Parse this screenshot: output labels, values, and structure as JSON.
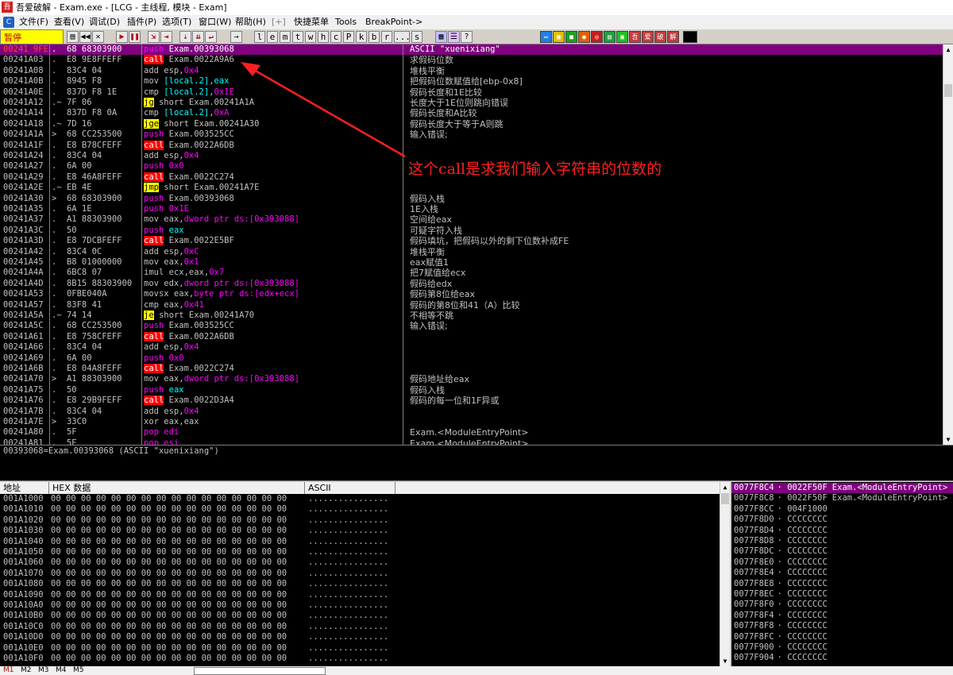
{
  "window": {
    "title": "吾爱破解 - Exam.exe - [LCG - 主线程, 模块 - Exam]",
    "icon": "52pojie-icon"
  },
  "menu": [
    "文件(F)",
    "查看(V)",
    "调试(D)",
    "插件(P)",
    "选项(T)",
    "窗口(W)",
    "帮助(H)",
    "[+]",
    "快捷菜单",
    "Tools",
    "BreakPoint->"
  ],
  "toolbar": {
    "status": "暂停",
    "letters": [
      "l",
      "e",
      "m",
      "t",
      "w",
      "h",
      "c",
      "P",
      "k",
      "b",
      "r",
      "...",
      "s"
    ],
    "tail_icons": [
      "吾",
      "爱",
      "破",
      "解"
    ]
  },
  "cpu_rows": [
    {
      "addr": "00241 9FE",
      "hex": ".  68 68303900",
      "dis": [
        [
          "push",
          "pushc"
        ],
        [
          " Exam.00393068",
          ""
        ]
      ],
      "sel": true
    },
    {
      "addr": "00241A03",
      "hex": ".  E8 9E8FFEFF",
      "dis": [
        [
          "call",
          "callbg"
        ],
        [
          " Exam.0022A9A6",
          ""
        ]
      ],
      "selcall": true
    },
    {
      "addr": "00241A08",
      "hex": ".  83C4 04",
      "dis": [
        [
          "add esp,",
          ""
        ],
        [
          "0x4",
          "imm"
        ]
      ]
    },
    {
      "addr": "00241A0B",
      "hex": ".  8945 F8",
      "dis": [
        [
          "mov ",
          ""
        ],
        [
          "[local.2]",
          "regc"
        ],
        [
          ",",
          ""
        ],
        [
          "eax",
          "regc"
        ]
      ]
    },
    {
      "addr": "00241A0E",
      "hex": ".  837D F8 1E",
      "dis": [
        [
          "cmp ",
          ""
        ],
        [
          "[local.2]",
          "regc"
        ],
        [
          ",",
          ""
        ],
        [
          "0x1E",
          "imm"
        ]
      ]
    },
    {
      "addr": "00241A12",
      "hex": ".~ 7F 06",
      "dis": [
        [
          "jg",
          "jmpbg"
        ],
        [
          " short Exam.00241A1A",
          ""
        ]
      ]
    },
    {
      "addr": "00241A14",
      "hex": ".  837D F8 0A",
      "dis": [
        [
          "cmp ",
          ""
        ],
        [
          "[local.2]",
          "regc"
        ],
        [
          ",",
          ""
        ],
        [
          "0xA",
          "imm"
        ]
      ]
    },
    {
      "addr": "00241A18",
      "hex": ".~ 7D 16",
      "dis": [
        [
          "jge",
          "jmpbg"
        ],
        [
          " short Exam.00241A30",
          ""
        ]
      ]
    },
    {
      "addr": "00241A1A",
      "hex": ">  68 CC253500",
      "dis": [
        [
          "push",
          "pushc"
        ],
        [
          " Exam.003525CC",
          ""
        ]
      ]
    },
    {
      "addr": "00241A1F",
      "hex": ".  E8 B78CFEFF",
      "dis": [
        [
          "call",
          "callbg"
        ],
        [
          " Exam.0022A6DB",
          ""
        ]
      ]
    },
    {
      "addr": "00241A24",
      "hex": ".  83C4 04",
      "dis": [
        [
          "add esp,",
          ""
        ],
        [
          "0x4",
          "imm"
        ]
      ]
    },
    {
      "addr": "00241A27",
      "hex": ".  6A 00",
      "dis": [
        [
          "push",
          "pushc"
        ],
        [
          " ",
          ""
        ],
        [
          "0x0",
          "imm"
        ]
      ]
    },
    {
      "addr": "00241A29",
      "hex": ".  E8 46A8FEFF",
      "dis": [
        [
          "call",
          "callbg"
        ],
        [
          " Exam.0022C274",
          ""
        ]
      ]
    },
    {
      "addr": "00241A2E",
      "hex": ".~ EB 4E",
      "dis": [
        [
          "jmp",
          "jmpbg"
        ],
        [
          " short Exam.00241A7E",
          ""
        ]
      ]
    },
    {
      "addr": "00241A30",
      "hex": ">  68 68303900",
      "dis": [
        [
          "push",
          "pushc"
        ],
        [
          " Exam.00393068",
          ""
        ]
      ]
    },
    {
      "addr": "00241A35",
      "hex": ".  6A 1E",
      "dis": [
        [
          "push",
          "pushc"
        ],
        [
          " ",
          ""
        ],
        [
          "0x1E",
          "imm"
        ]
      ]
    },
    {
      "addr": "00241A37",
      "hex": ".  A1 88303900",
      "dis": [
        [
          "mov eax,",
          ""
        ],
        [
          "dword ptr ds:[0x393088]",
          "memc"
        ]
      ]
    },
    {
      "addr": "00241A3C",
      "hex": ".  50",
      "dis": [
        [
          "push",
          "pushc"
        ],
        [
          " ",
          ""
        ],
        [
          "eax",
          "regc"
        ]
      ]
    },
    {
      "addr": "00241A3D",
      "hex": ".  E8 7DCBFEFF",
      "dis": [
        [
          "call",
          "callbg"
        ],
        [
          " Exam.0022E5BF",
          ""
        ]
      ]
    },
    {
      "addr": "00241A42",
      "hex": ".  83C4 0C",
      "dis": [
        [
          "add esp,",
          ""
        ],
        [
          "0xC",
          "imm"
        ]
      ]
    },
    {
      "addr": "00241A45",
      "hex": ".  B8 01000000",
      "dis": [
        [
          "mov eax,",
          ""
        ],
        [
          "0x1",
          "imm"
        ]
      ]
    },
    {
      "addr": "00241A4A",
      "hex": ".  6BC8 07",
      "dis": [
        [
          "imul ecx,eax,",
          ""
        ],
        [
          "0x7",
          "imm"
        ]
      ]
    },
    {
      "addr": "00241A4D",
      "hex": ".  8B15 88303900",
      "dis": [
        [
          "mov edx,",
          ""
        ],
        [
          "dword ptr ds:[0x393088]",
          "memc"
        ]
      ]
    },
    {
      "addr": "00241A53",
      "hex": ".  0FBE040A",
      "dis": [
        [
          "movsx eax,",
          ""
        ],
        [
          "byte ptr ds:[edx+ecx]",
          "memc"
        ]
      ]
    },
    {
      "addr": "00241A57",
      "hex": ".  83F8 41",
      "dis": [
        [
          "cmp eax,",
          ""
        ],
        [
          "0x41",
          "imm"
        ]
      ]
    },
    {
      "addr": "00241A5A",
      "hex": ".~ 74 14",
      "dis": [
        [
          "je",
          "jmpbg"
        ],
        [
          " short Exam.00241A70",
          ""
        ]
      ]
    },
    {
      "addr": "00241A5C",
      "hex": ".  68 CC253500",
      "dis": [
        [
          "push",
          "pushc"
        ],
        [
          " Exam.003525CC",
          ""
        ]
      ]
    },
    {
      "addr": "00241A61",
      "hex": ".  E8 758CFEFF",
      "dis": [
        [
          "call",
          "callbg"
        ],
        [
          " Exam.0022A6DB",
          ""
        ]
      ]
    },
    {
      "addr": "00241A66",
      "hex": ".  83C4 04",
      "dis": [
        [
          "add esp,",
          ""
        ],
        [
          "0x4",
          "imm"
        ]
      ]
    },
    {
      "addr": "00241A69",
      "hex": ".  6A 00",
      "dis": [
        [
          "push",
          "pushc"
        ],
        [
          " ",
          ""
        ],
        [
          "0x0",
          "imm"
        ]
      ]
    },
    {
      "addr": "00241A6B",
      "hex": ".  E8 04A8FEFF",
      "dis": [
        [
          "call",
          "callbg"
        ],
        [
          " Exam.0022C274",
          ""
        ]
      ]
    },
    {
      "addr": "00241A70",
      "hex": ">  A1 88303900",
      "dis": [
        [
          "mov eax,",
          ""
        ],
        [
          "dword ptr ds:[0x393088]",
          "memc"
        ]
      ]
    },
    {
      "addr": "00241A75",
      "hex": ".  50",
      "dis": [
        [
          "push",
          "pushc"
        ],
        [
          " ",
          ""
        ],
        [
          "eax",
          "regc"
        ]
      ]
    },
    {
      "addr": "00241A76",
      "hex": ".  E8 29B9FEFF",
      "dis": [
        [
          "call",
          "callbg"
        ],
        [
          " Exam.0022D3A4",
          ""
        ]
      ]
    },
    {
      "addr": "00241A7B",
      "hex": ".  83C4 04",
      "dis": [
        [
          "add esp,",
          ""
        ],
        [
          "0x4",
          "imm"
        ]
      ]
    },
    {
      "addr": "00241A7E",
      "hex": ">  33C0",
      "dis": [
        [
          "xor eax,eax",
          ""
        ]
      ]
    },
    {
      "addr": "00241A80",
      "hex": ".  5F",
      "dis": [
        [
          "pop edi",
          "pushc"
        ]
      ]
    },
    {
      "addr": "00241A81",
      "hex": ".  5E",
      "dis": [
        [
          "pop esi",
          "pushc"
        ]
      ]
    }
  ],
  "comments": [
    {
      "row": 0,
      "text": "ASCII \"xuenixiang\""
    },
    {
      "row": 1,
      "text": "求假码位数"
    },
    {
      "row": 2,
      "text": "堆栈平衡"
    },
    {
      "row": 3,
      "text": "把假码位数赋值给[ebp-0x8]"
    },
    {
      "row": 4,
      "text": "假码长度和1E比较"
    },
    {
      "row": 5,
      "text": "长度大于1E位则跳向错误"
    },
    {
      "row": 6,
      "text": "假码长度和A比较"
    },
    {
      "row": 7,
      "text": "假码长度大于等于A则跳"
    },
    {
      "row": 8,
      "text": "输入错误;"
    },
    {
      "row": 14,
      "text": "假码入栈"
    },
    {
      "row": 15,
      "text": "1E入栈"
    },
    {
      "row": 16,
      "text": "空间给eax"
    },
    {
      "row": 17,
      "text": "可疑字符入栈"
    },
    {
      "row": 18,
      "text": "假码填坑，把假码以外的剩下位数补成FE"
    },
    {
      "row": 19,
      "text": "堆栈平衡"
    },
    {
      "row": 20,
      "text": "eax赋值1"
    },
    {
      "row": 21,
      "text": "把7赋值给ecx"
    },
    {
      "row": 22,
      "text": "假码给edx"
    },
    {
      "row": 23,
      "text": "假码第8位给eax"
    },
    {
      "row": 24,
      "text": "假码的第8位和41（A）比较"
    },
    {
      "row": 25,
      "text": "不相等不跳"
    },
    {
      "row": 26,
      "text": "输入错误;"
    },
    {
      "row": 31,
      "text": "假码地址给eax"
    },
    {
      "row": 32,
      "text": "假码入栈"
    },
    {
      "row": 33,
      "text": "假码的每一位和1F异或"
    },
    {
      "row": 36,
      "text": "Exam.<ModuleEntryPoint>"
    },
    {
      "row": 37,
      "text": "Exam.<ModuleEntryPoint>"
    }
  ],
  "annotation": "这个call是求我们输入字符串的位数的",
  "info_line": "00393068=Exam.00393068 (ASCII \"xuenixiang\")",
  "dump": {
    "headers": {
      "addr": "地址",
      "hex": "HEX 数据",
      "ascii": "ASCII"
    },
    "rows": [
      "001A1000",
      "001A1010",
      "001A1020",
      "001A1030",
      "001A1040",
      "001A1050",
      "001A1060",
      "001A1070",
      "001A1080",
      "001A1090",
      "001A10A0",
      "001A10B0",
      "001A10C0",
      "001A10D0",
      "001A10E0",
      "001A10F0"
    ],
    "hex": "00 00 00 00 00 00 00 00 00 00 00 00 00 00 00 00",
    "ascii": "................"
  },
  "stack": [
    {
      "addr": "0077F8C4",
      "val": "0022F50F",
      "cmt": "Exam.<ModuleEntryPoint>",
      "sel": true
    },
    {
      "addr": "0077F8C8",
      "val": "0022F50F",
      "cmt": "Exam.<ModuleEntryPoint>"
    },
    {
      "addr": "0077F8CC",
      "val": "004F1000",
      "cmt": ""
    },
    {
      "addr": "0077F8D0",
      "val": "CCCCCCCC",
      "cmt": ""
    },
    {
      "addr": "0077F8D4",
      "val": "CCCCCCCC",
      "cmt": ""
    },
    {
      "addr": "0077F8D8",
      "val": "CCCCCCCC",
      "cmt": ""
    },
    {
      "addr": "0077F8DC",
      "val": "CCCCCCCC",
      "cmt": ""
    },
    {
      "addr": "0077F8E0",
      "val": "CCCCCCCC",
      "cmt": ""
    },
    {
      "addr": "0077F8E4",
      "val": "CCCCCCCC",
      "cmt": ""
    },
    {
      "addr": "0077F8E8",
      "val": "CCCCCCCC",
      "cmt": ""
    },
    {
      "addr": "0077F8EC",
      "val": "CCCCCCCC",
      "cmt": ""
    },
    {
      "addr": "0077F8F0",
      "val": "CCCCCCCC",
      "cmt": ""
    },
    {
      "addr": "0077F8F4",
      "val": "CCCCCCCC",
      "cmt": ""
    },
    {
      "addr": "0077F8F8",
      "val": "CCCCCCCC",
      "cmt": ""
    },
    {
      "addr": "0077F8FC",
      "val": "CCCCCCCC",
      "cmt": ""
    },
    {
      "addr": "0077F900",
      "val": "CCCCCCCC",
      "cmt": ""
    },
    {
      "addr": "0077F904",
      "val": "CCCCCCCC",
      "cmt": ""
    }
  ],
  "bottom_tabs": [
    "M1",
    "M2",
    "M3",
    "M4",
    "M5"
  ]
}
